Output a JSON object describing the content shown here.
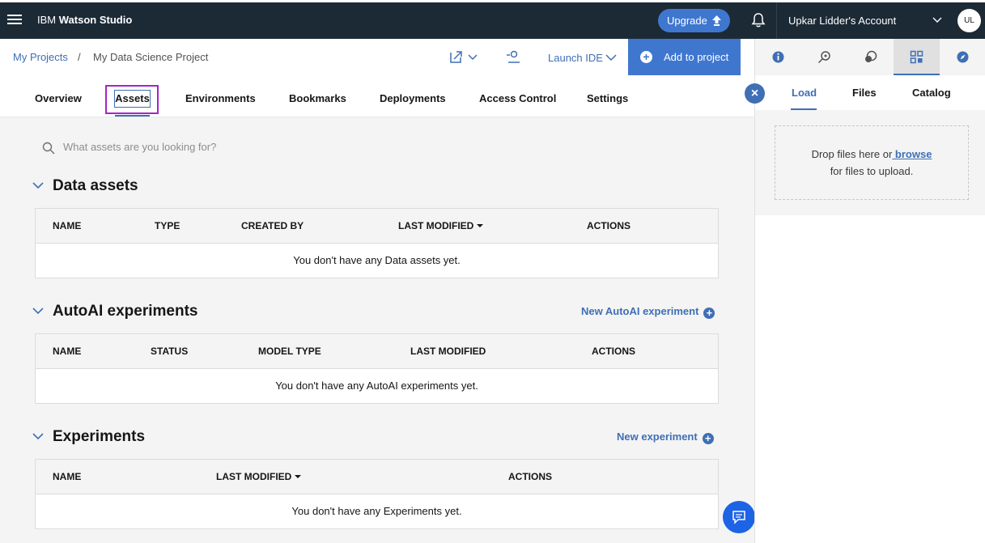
{
  "header": {
    "brand_prefix": "IBM",
    "brand_name": "Watson Studio",
    "upgrade_label": "Upgrade",
    "account_label": "Upkar Lidder's Account",
    "avatar_initials": "UL"
  },
  "breadcrumb": {
    "root": "My Projects",
    "separator": "/",
    "current": "My Data Science Project"
  },
  "toolbar": {
    "launch_ide_label": "Launch IDE",
    "add_to_project_label": "Add to project"
  },
  "tabs": [
    {
      "label": "Overview"
    },
    {
      "label": "Assets"
    },
    {
      "label": "Environments"
    },
    {
      "label": "Bookmarks"
    },
    {
      "label": "Deployments"
    },
    {
      "label": "Access Control"
    },
    {
      "label": "Settings"
    }
  ],
  "search": {
    "placeholder": "What assets are you looking for?"
  },
  "sections": {
    "data_assets": {
      "title": "Data assets",
      "columns": [
        "NAME",
        "TYPE",
        "CREATED BY",
        "LAST MODIFIED",
        "ACTIONS"
      ],
      "empty_text": "You don't have any Data assets yet."
    },
    "autoai": {
      "title": "AutoAI experiments",
      "action_label": "New AutoAI experiment",
      "columns": [
        "NAME",
        "STATUS",
        "MODEL TYPE",
        "LAST MODIFIED",
        "ACTIONS"
      ],
      "empty_text": "You don't have any AutoAI experiments yet."
    },
    "experiments": {
      "title": "Experiments",
      "action_label": "New experiment",
      "columns": [
        "NAME",
        "LAST MODIFIED",
        "ACTIONS"
      ],
      "empty_text": "You don't have any Experiments yet."
    }
  },
  "right_panel": {
    "tabs": [
      {
        "label": "Load"
      },
      {
        "label": "Files"
      },
      {
        "label": "Catalog"
      }
    ],
    "drop_text_before": "Drop files here or",
    "browse_label": " browse",
    "drop_text_after": "for files to upload.",
    "icons": [
      "info-icon",
      "search-settings-icon",
      "chat-icon",
      "data-icon",
      "compass-icon"
    ]
  },
  "colors": {
    "header_bg": "#1c2a36",
    "accent_blue": "#3f77cf",
    "link_blue": "#3f6fb5",
    "highlight_purple": "#a526c9"
  }
}
